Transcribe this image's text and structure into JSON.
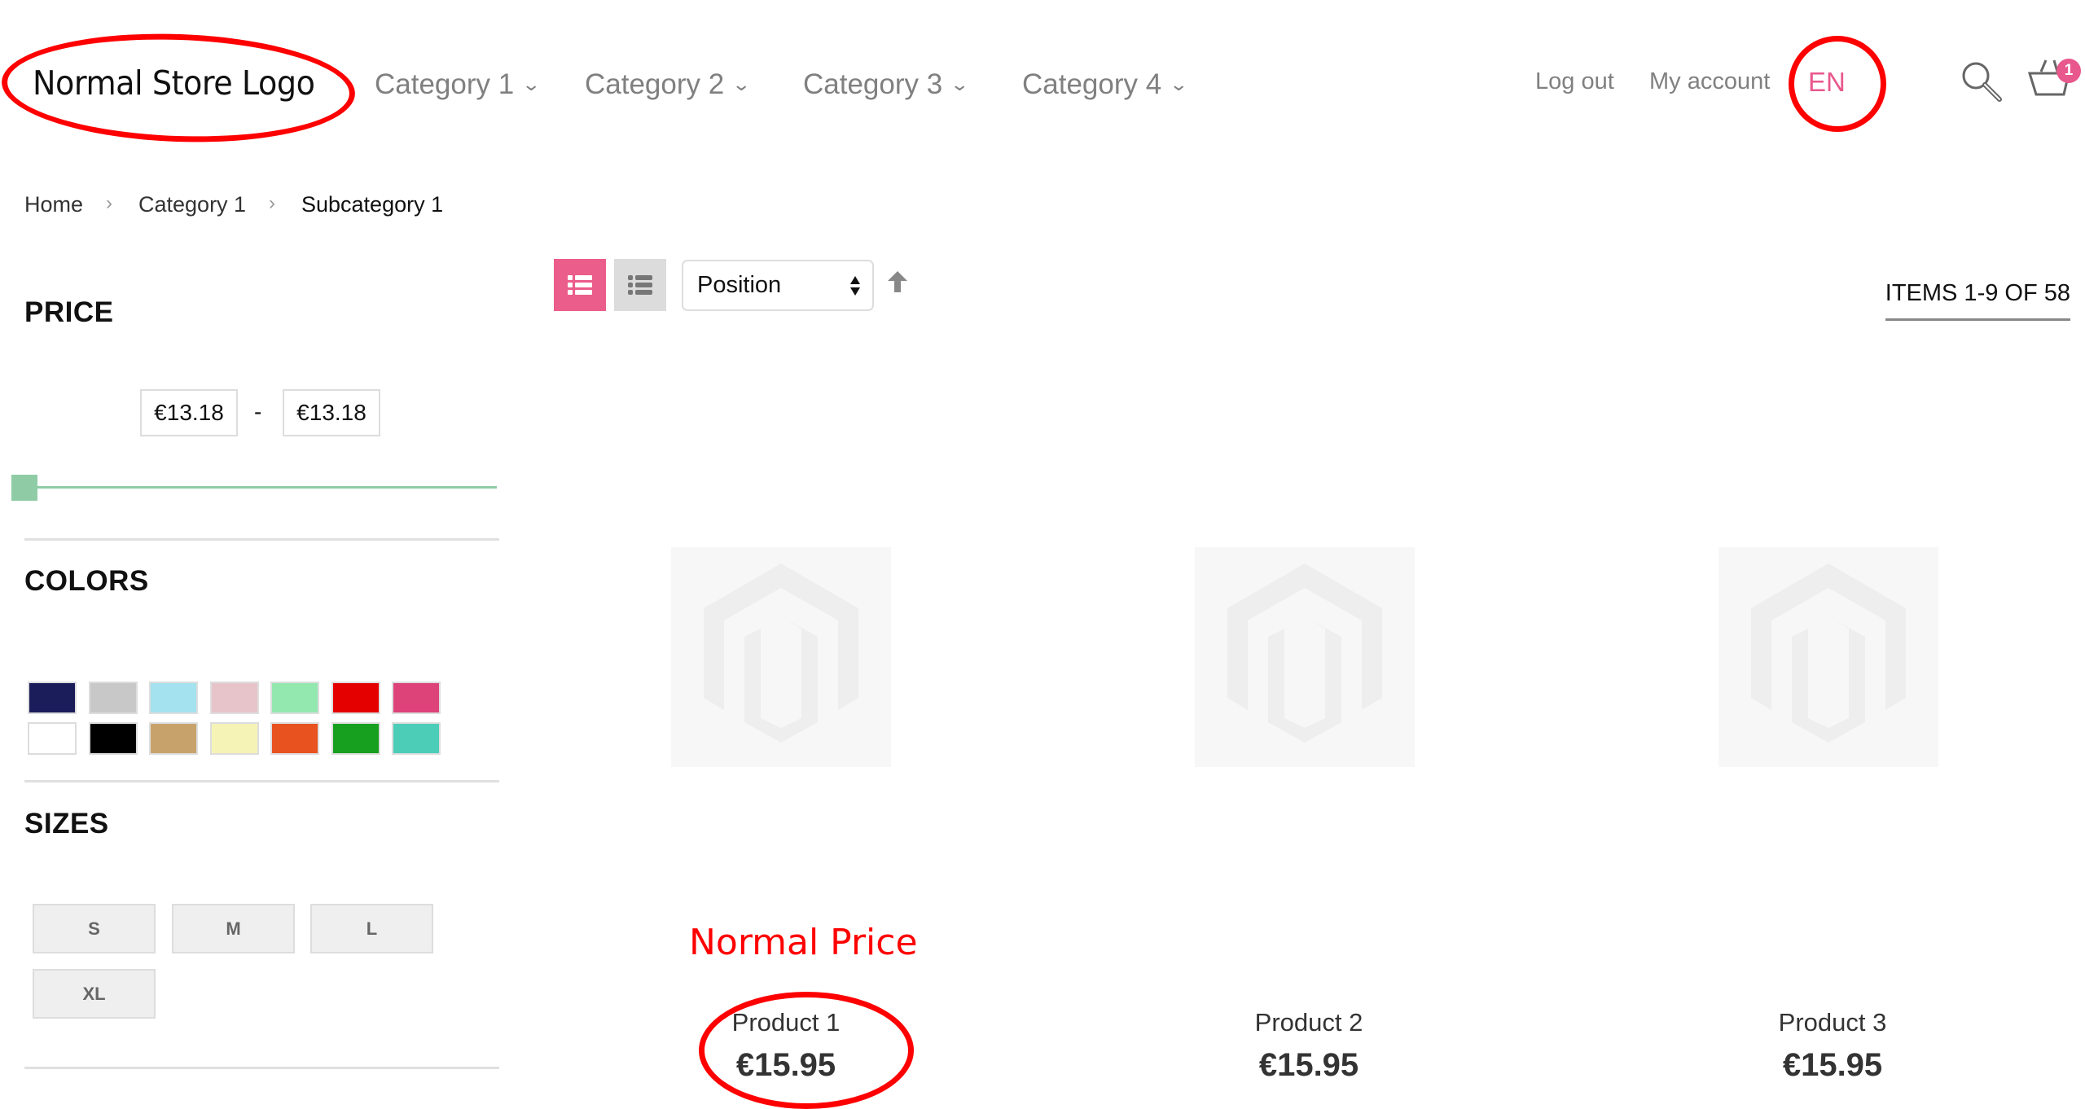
{
  "header": {
    "logo_text": "Normal Store Logo",
    "nav": [
      {
        "label": "Category 1"
      },
      {
        "label": "Category 2"
      },
      {
        "label": "Category 3"
      },
      {
        "label": "Category 4"
      }
    ],
    "logout_label": "Log out",
    "account_label": "My account",
    "language": "EN",
    "search_icon": "search-icon",
    "cart_icon": "basket-icon",
    "cart_count": "1"
  },
  "breadcrumb": [
    {
      "label": "Home"
    },
    {
      "label": "Category 1"
    },
    {
      "label": "Subcategory 1"
    }
  ],
  "filters": {
    "price": {
      "title": "PRICE",
      "min_value": "€13.18",
      "separator": "-",
      "max_value": "€13.18",
      "slider_position_fraction": 0
    },
    "colors": {
      "title": "COLORS",
      "swatches": [
        "#1b1d5a",
        "#c8c8c8",
        "#a3e2ee",
        "#e6c4ca",
        "#93e8af",
        "#e50000",
        "#dd4279",
        "#ffffff",
        "#000000",
        "#c7a36b",
        "#f6f3b7",
        "#e8521e",
        "#17a01f",
        "#4bcdb8"
      ]
    },
    "sizes": {
      "title": "SIZES",
      "options": [
        "S",
        "M",
        "L",
        "XL"
      ]
    }
  },
  "toolbar": {
    "grid_mode_icon": "grid-view-icon",
    "list_mode_icon": "list-view-icon",
    "sort_selected": "Position",
    "sort_direction_icon": "arrow-up-icon",
    "items_count": "ITEMS 1-9 OF 58"
  },
  "products": [
    {
      "name": "Product 1",
      "price": "€15.95"
    },
    {
      "name": "Product 2",
      "price": "€15.95"
    },
    {
      "name": "Product 3",
      "price": "€15.95"
    }
  ],
  "annotations": {
    "normal_price_label": "Normal Price"
  },
  "colors": {
    "accent": "#e8588c",
    "slider": "#8fcca6",
    "annotation": "#ff0000"
  }
}
